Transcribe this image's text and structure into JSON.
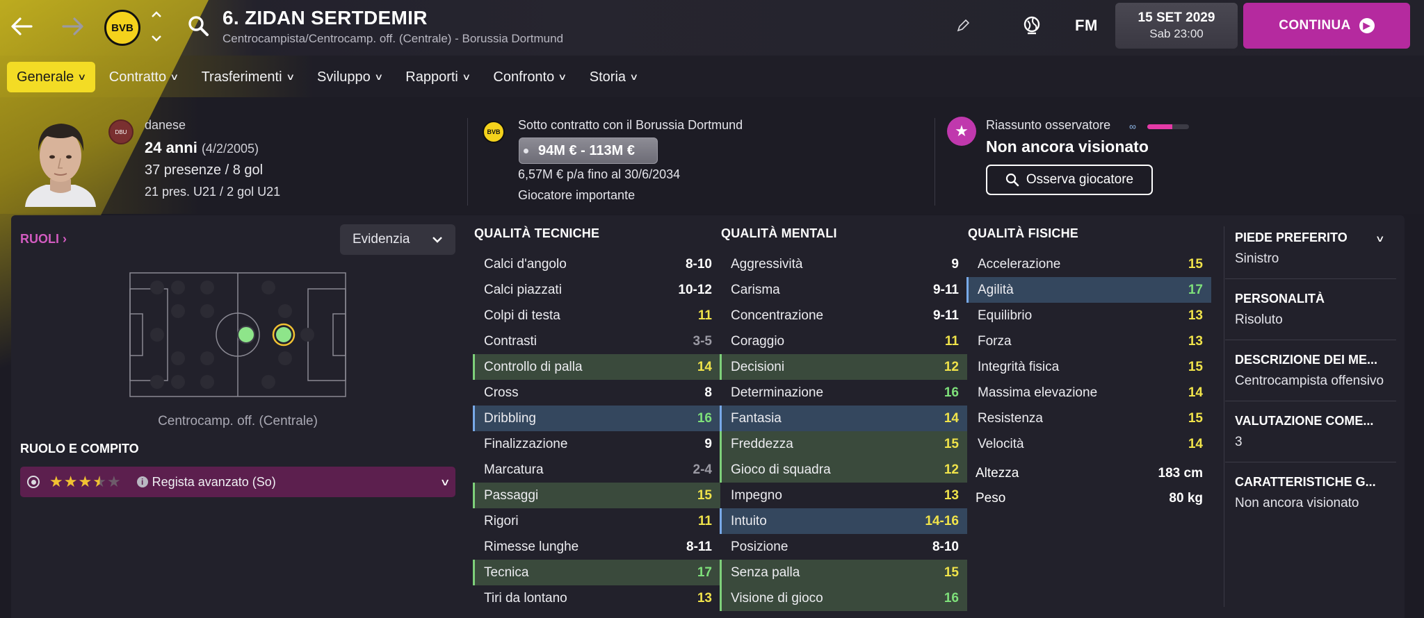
{
  "header": {
    "title": "6. ZIDAN SERTDEMIR",
    "subtitle": "Centrocampista/Centrocamp. off. (Centrale) - Borussia Dortmund",
    "club_badge_text": "BVB",
    "fm_logo": "FM",
    "date": "15 SET 2029",
    "time": "Sab 23:00",
    "continue_label": "CONTINUA"
  },
  "tabs": [
    {
      "label": "Generale",
      "active": true
    },
    {
      "label": "Contratto"
    },
    {
      "label": "Trasferimenti"
    },
    {
      "label": "Sviluppo"
    },
    {
      "label": "Rapporti"
    },
    {
      "label": "Confronto"
    },
    {
      "label": "Storia"
    }
  ],
  "profile": {
    "nationality": "danese",
    "age": "24 anni",
    "dob": "(4/2/2005)",
    "apps": "37 presenze / 8 gol",
    "u21": "21 pres. U21 / 2 gol U21"
  },
  "contract": {
    "club_text": "Sotto contratto con il Borussia Dortmund",
    "value": "94M € - 113M €",
    "wage": "6,57M € p/a fino al 30/6/2034",
    "status": "Giocatore importante"
  },
  "scout": {
    "label": "Riassunto osservatore",
    "status": "Non ancora visionato",
    "button": "Osserva giocatore",
    "progress": 0.6,
    "bar_color": "#e43aa6"
  },
  "roles": {
    "heading": "RUOLI",
    "highlight_button": "Evidenzia",
    "position_label": "Centrocamp. off. (Centrale)",
    "role_heading": "RUOLO E COMPITO",
    "role_name": "Regista avanzato (So)",
    "stars": 3.5,
    "stars_max": 5
  },
  "technical": {
    "heading": "QUALITÀ TECNICHE",
    "rows": [
      {
        "name": "Calci d'angolo",
        "value": "8-10"
      },
      {
        "name": "Calci piazzati",
        "value": "10-12"
      },
      {
        "name": "Colpi di testa",
        "value": "11"
      },
      {
        "name": "Contrasti",
        "value": "3-5"
      },
      {
        "name": "Controllo di palla",
        "value": "14",
        "hl": "green"
      },
      {
        "name": "Cross",
        "value": "8"
      },
      {
        "name": "Dribbling",
        "value": "16",
        "hl": "blue"
      },
      {
        "name": "Finalizzazione",
        "value": "9"
      },
      {
        "name": "Marcatura",
        "value": "2-4"
      },
      {
        "name": "Passaggi",
        "value": "15",
        "hl": "green"
      },
      {
        "name": "Rigori",
        "value": "11"
      },
      {
        "name": "Rimesse lunghe",
        "value": "8-11"
      },
      {
        "name": "Tecnica",
        "value": "17",
        "hl": "green"
      },
      {
        "name": "Tiri da lontano",
        "value": "13"
      }
    ]
  },
  "mental": {
    "heading": "QUALITÀ MENTALI",
    "rows": [
      {
        "name": "Aggressività",
        "value": "9"
      },
      {
        "name": "Carisma",
        "value": "9-11"
      },
      {
        "name": "Concentrazione",
        "value": "9-11"
      },
      {
        "name": "Coraggio",
        "value": "11"
      },
      {
        "name": "Decisioni",
        "value": "12",
        "hl": "green"
      },
      {
        "name": "Determinazione",
        "value": "16"
      },
      {
        "name": "Fantasia",
        "value": "14",
        "hl": "blue"
      },
      {
        "name": "Freddezza",
        "value": "15",
        "hl": "green"
      },
      {
        "name": "Gioco di squadra",
        "value": "12",
        "hl": "green"
      },
      {
        "name": "Impegno",
        "value": "13"
      },
      {
        "name": "Intuito",
        "value": "14-16",
        "hl": "blue"
      },
      {
        "name": "Posizione",
        "value": "8-10"
      },
      {
        "name": "Senza palla",
        "value": "15",
        "hl": "green"
      },
      {
        "name": "Visione di gioco",
        "value": "16",
        "hl": "green"
      }
    ]
  },
  "physical": {
    "heading": "QUALITÀ FISICHE",
    "rows": [
      {
        "name": "Accelerazione",
        "value": "15"
      },
      {
        "name": "Agilità",
        "value": "17",
        "hl": "blue"
      },
      {
        "name": "Equilibrio",
        "value": "13"
      },
      {
        "name": "Forza",
        "value": "13"
      },
      {
        "name": "Integrità fisica",
        "value": "15"
      },
      {
        "name": "Massima elevazione",
        "value": "14"
      },
      {
        "name": "Resistenza",
        "value": "15"
      },
      {
        "name": "Velocità",
        "value": "14"
      }
    ],
    "height_label": "Altezza",
    "height": "183 cm",
    "weight_label": "Peso",
    "weight": "80 kg"
  },
  "info_panel": [
    {
      "heading": "PIEDE PREFERITO",
      "text": "Sinistro"
    },
    {
      "heading": "PERSONALITÀ",
      "text": "Risoluto"
    },
    {
      "heading": "DESCRIZIONE DEI ME...",
      "text": "Centrocampista offensivo"
    },
    {
      "heading": "VALUTAZIONE COME...",
      "text": "3"
    },
    {
      "heading": "CARATTERISTICHE G...",
      "text": "Non ancora visionato"
    }
  ],
  "colors": {
    "accent": "#f3dc25",
    "brand": "#b52a9f",
    "range_grey": "#9b9aa4",
    "val_mid": "#f0e34a",
    "val_high": "#7ee07a",
    "val_white": "#ffffff"
  }
}
